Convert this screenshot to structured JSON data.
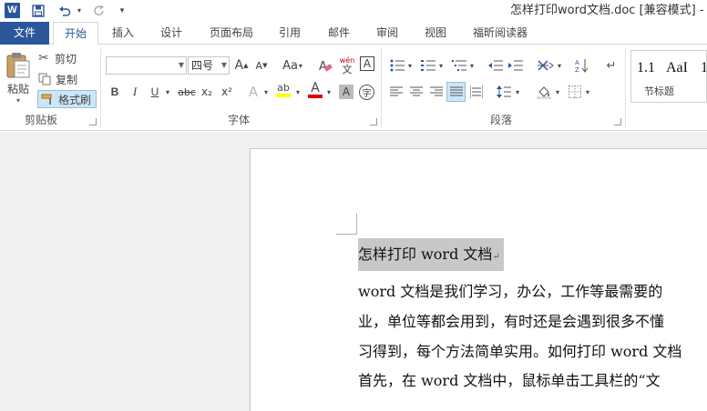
{
  "titlebar": {
    "title": "怎样打印word文档.doc [兼容模式] - Wo"
  },
  "tabs": [
    {
      "label": "文件"
    },
    {
      "label": "开始"
    },
    {
      "label": "插入"
    },
    {
      "label": "设计"
    },
    {
      "label": "页面布局"
    },
    {
      "label": "引用"
    },
    {
      "label": "邮件"
    },
    {
      "label": "审阅"
    },
    {
      "label": "视图"
    },
    {
      "label": "福昕阅读器"
    }
  ],
  "clipboard": {
    "paste_label": "粘贴",
    "cut_label": "剪切",
    "copy_label": "复制",
    "format_painter_label": "格式刷",
    "group_label": "剪贴板"
  },
  "font": {
    "font_name_value": "",
    "font_size_value": "四号",
    "group_label": "字体",
    "bold": "B",
    "italic": "I",
    "underline": "U",
    "strikethrough": "abc",
    "subscript": "x₂",
    "superscript": "x²",
    "grow": "A",
    "shrink": "A",
    "change_case": "Aa",
    "pinyin_top": "wén",
    "pinyin_bottom": "文",
    "char_border": "A",
    "text_effect": "A",
    "highlight": "ab",
    "font_color": "A",
    "char_shading": "A",
    "enclose_char": "字"
  },
  "paragraph": {
    "group_label": "段落"
  },
  "styles": {
    "sample1": "1.1",
    "sample2": "AaI",
    "sample3": "1",
    "caption": "节标题"
  },
  "document": {
    "title": "怎样打印 word 文档",
    "lines": [
      "word  文档是我们学习，办公，工作等最需要的",
      "业，单位等都会用到，有时还是会遇到很多不懂",
      "习得到，每个方法简单实用。如何打印 word 文档",
      "首先，在 word 文档中，鼠标单击工具栏的“文"
    ]
  },
  "colors": {
    "accent": "#2b579a",
    "highlight_yellow": "#ffff00",
    "font_red": "#e00000"
  }
}
